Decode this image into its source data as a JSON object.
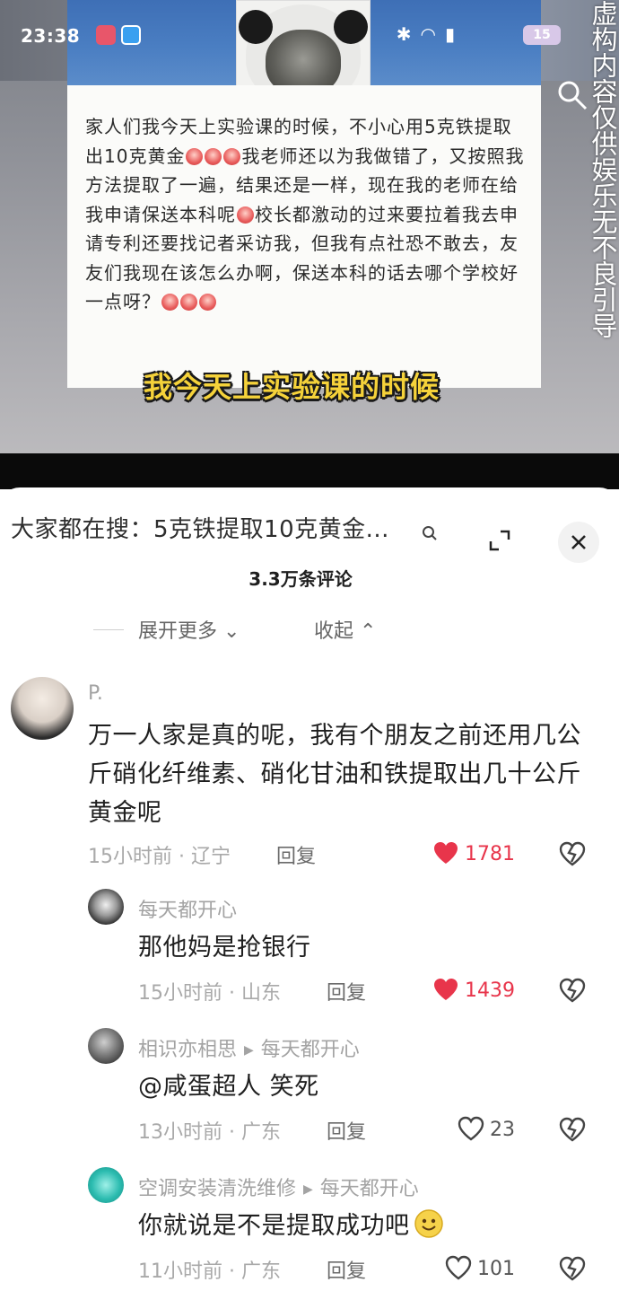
{
  "status_bar": {
    "time": "23:38",
    "battery": "15"
  },
  "video": {
    "post_text": "家人们我今天上实验课的时候，不小心用5克铁提取出10克黄金",
    "post_text_2": "我老师还以为我做错了，又按照我方法提取了一遍，结果还是一样，现在我的老师在给我申请保送本科呢",
    "post_text_3": "校长都激动的过来要拉着我去申请专利还要找记者采访我，但我有点社恐不敢去，友友们我现在该怎么办啊，保送本科的话去哪个学校好一点呀？",
    "caption": "我今天上实验课的时候",
    "disclaimer": "虚构内容仅供娱乐无不良引导"
  },
  "sheet": {
    "search_text": "大家都在搜：5克铁提取10克黄金...",
    "comment_count": "3.3万条评论",
    "expand_more": "展开更多",
    "collapse": "收起"
  },
  "comments": [
    {
      "username": "P.",
      "text": "万一人家是真的呢，我有个朋友之前还用几公斤硝化纤维素、硝化甘油和铁提取出几十公斤黄金呢",
      "meta": "15小时前 · 辽宁",
      "reply": "回复",
      "likes": "1781",
      "liked": true
    },
    {
      "username": "每天都开心",
      "text": "那他妈是抢银行",
      "meta": "15小时前 · 山东",
      "reply": "回复",
      "likes": "1439",
      "liked": true
    },
    {
      "username": "相识亦相思",
      "reply_to": "每天都开心",
      "text": "@咸蛋超人 笑死",
      "meta": "13小时前 · 广东",
      "reply": "回复",
      "likes": "23",
      "liked": false
    },
    {
      "username": "空调安装清洗维修",
      "reply_to": "每天都开心",
      "text": "你就说是不是提取成功吧",
      "meta": "11小时前 · 广东",
      "reply": "回复",
      "likes": "101",
      "liked": false
    }
  ],
  "colors": {
    "like_red": "#e8354b",
    "caption_yellow": "#f5d23a",
    "status_blue": "#4a7ec2"
  },
  "icons": [
    "search-icon",
    "expand-icon",
    "close-icon",
    "heart-icon",
    "dislike-icon",
    "chevron-down-icon",
    "chevron-up-icon",
    "lens-icon",
    "wifi-icon",
    "bluetooth-icon",
    "smile-emoji-icon"
  ]
}
